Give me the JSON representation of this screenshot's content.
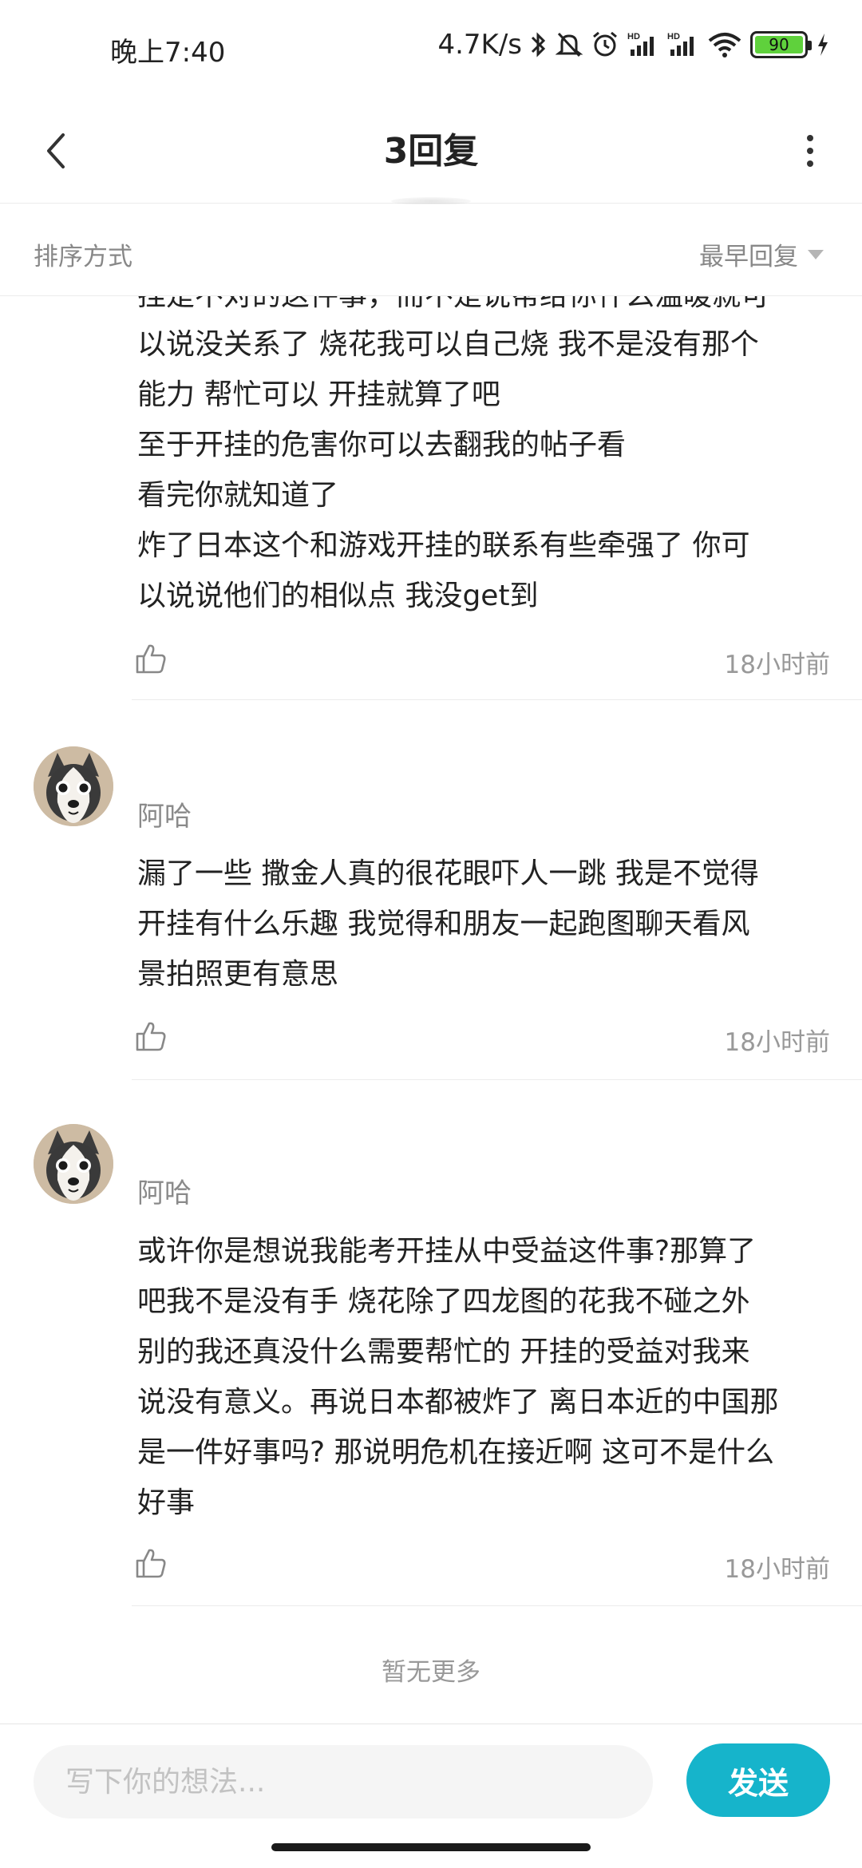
{
  "status_bar": {
    "time": "晚上7:40",
    "network_speed": "4.7K/s",
    "battery": "90",
    "icons": [
      "bluetooth-icon",
      "mute-icon",
      "alarm-icon",
      "signal-hd-icon",
      "signal-hd-icon",
      "wifi-icon",
      "battery-icon",
      "charging-icon"
    ]
  },
  "header": {
    "title": "3回复",
    "back_icon": "chevron-left-icon",
    "more_icon": "more-vertical-icon"
  },
  "sort": {
    "label": "排序方式",
    "selected": "最早回复"
  },
  "replies": [
    {
      "author": "",
      "lines": [
        "挂是不对的这件事，而不是说帮给你什么温暖就可",
        "以说没关系了 烧花我可以自己烧 我不是没有那个",
        "能力 帮忙可以 开挂就算了吧",
        "至于开挂的危害你可以去翻我的帖子看",
        "看完你就知道了",
        "炸了日本这个和游戏开挂的联系有些牵强了 你可",
        "以说说他们的相似点 我没get到"
      ],
      "time": "18小时前"
    },
    {
      "author": "阿哈",
      "lines": [
        "漏了一些 撒金人真的很花眼吓人一跳 我是不觉得",
        "开挂有什么乐趣 我觉得和朋友一起跑图聊天看风",
        "景拍照更有意思"
      ],
      "time": "18小时前"
    },
    {
      "author": "阿哈",
      "lines": [
        "或许你是想说我能考开挂从中受益这件事?那算了",
        "吧我不是没有手 烧花除了四龙图的花我不碰之外",
        "别的我还真没什么需要帮忙的 开挂的受益对我来",
        "说没有意义。再说日本都被炸了 离日本近的中国那",
        "是一件好事吗? 那说明危机在接近啊 这可不是什么",
        "好事"
      ],
      "time": "18小时前"
    }
  ],
  "no_more": "暂无更多",
  "composer": {
    "placeholder": "写下你的想法...",
    "send_label": "发送"
  },
  "colors": {
    "accent": "#16b4cb",
    "meta_text": "#999999",
    "battery_green": "#5fd13c"
  }
}
